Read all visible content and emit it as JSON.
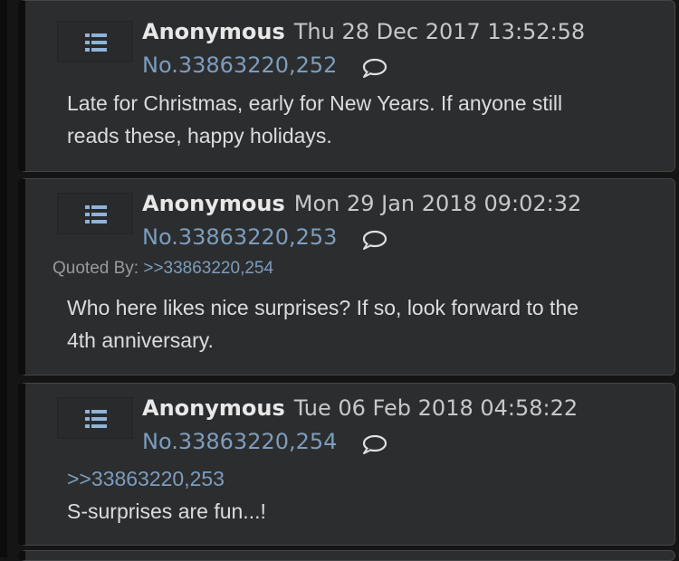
{
  "posts": [
    {
      "name": "Anonymous",
      "date": "Thu 28 Dec 2017 13:52:58",
      "post_number": "No.33863220,252",
      "body": [
        "Late for Christmas, early for New Years. If anyone still",
        "reads these, happy holidays."
      ]
    },
    {
      "name": "Anonymous",
      "date": "Mon 29 Jan 2018 09:02:32",
      "post_number": "No.33863220,253",
      "quoted_by_label": "Quoted By:",
      "quoted_by_link": ">>33863220,254",
      "body": [
        "Who here likes nice surprises? If so, look forward to the",
        "4th anniversary."
      ]
    },
    {
      "name": "Anonymous",
      "date": "Tue 06 Feb 2018 04:58:22",
      "post_number": "No.33863220,254",
      "quote_link": ">>33863220,253",
      "body": [
        "S-surprises are fun...!"
      ]
    }
  ],
  "icons": {
    "menu": "menu-list-icon",
    "reply": "speech-bubble-icon"
  },
  "colors": {
    "background": "#151515",
    "post_bg": "#2c2d2f",
    "link": "#7d9dbd",
    "name": "#e8e8e8"
  }
}
